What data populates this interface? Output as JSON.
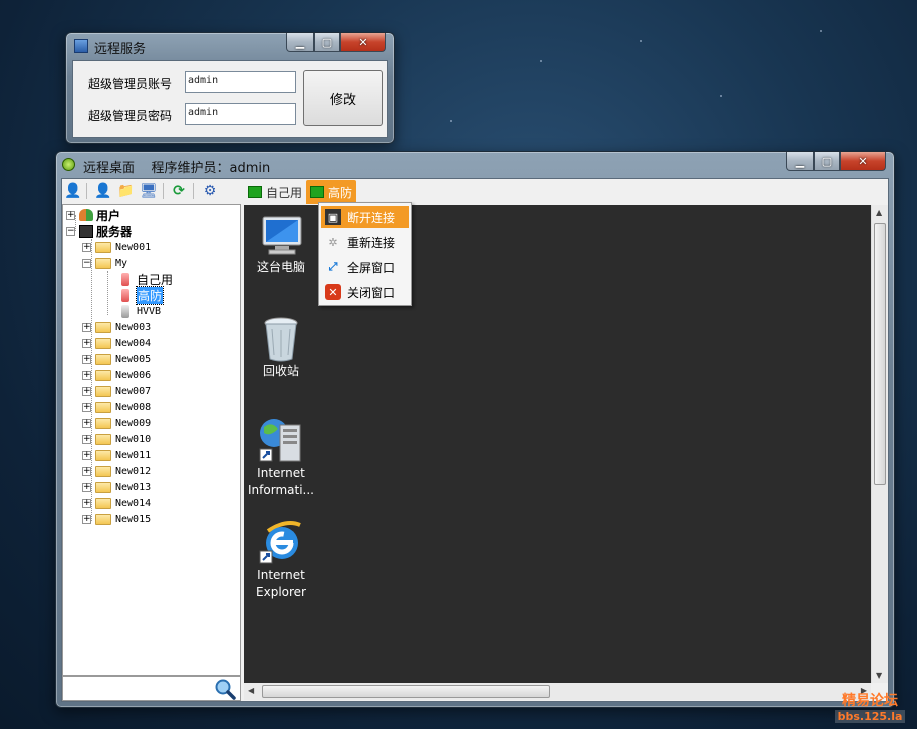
{
  "dialog": {
    "title": "远程服务",
    "account_label": "超级管理员账号",
    "account_value": "admin",
    "password_label": "超级管理员密码",
    "password_value": "admin",
    "modify_button": "修改"
  },
  "main": {
    "title": "远程桌面    程序维护员：admin",
    "caption": {
      "minimize": "▁",
      "maximize": "▢",
      "close": "✕"
    }
  },
  "tree": {
    "root_users": "用户",
    "root_servers": "服务器",
    "folders_top": [
      "New001",
      "My"
    ],
    "my_children": [
      "自己用",
      "高防",
      "HVVB"
    ],
    "folders_bottom": [
      "New003",
      "New004",
      "New005",
      "New006",
      "New007",
      "New008",
      "New009",
      "New010",
      "New011",
      "New012",
      "New013",
      "New014",
      "New015"
    ]
  },
  "tabs": [
    "自己用",
    "高防"
  ],
  "desktop_icons": [
    {
      "label": "这台电脑",
      "icon": "computer-icon"
    },
    {
      "label": "回收站",
      "icon": "recycle-bin-icon"
    },
    {
      "label": "Internet Informati...",
      "icon": "iis-icon"
    },
    {
      "label": "Internet Explorer",
      "icon": "ie-icon"
    }
  ],
  "context_menu": [
    "断开连接",
    "重新连接",
    "全屏窗口",
    "关闭窗口"
  ],
  "watermark": {
    "line1": "精易论坛",
    "line2": "bbs.125.la"
  },
  "colors": {
    "accent_orange": "#f08a1f",
    "desktop_bg": "#2c2c2c",
    "tab_active": "#f39a25"
  }
}
